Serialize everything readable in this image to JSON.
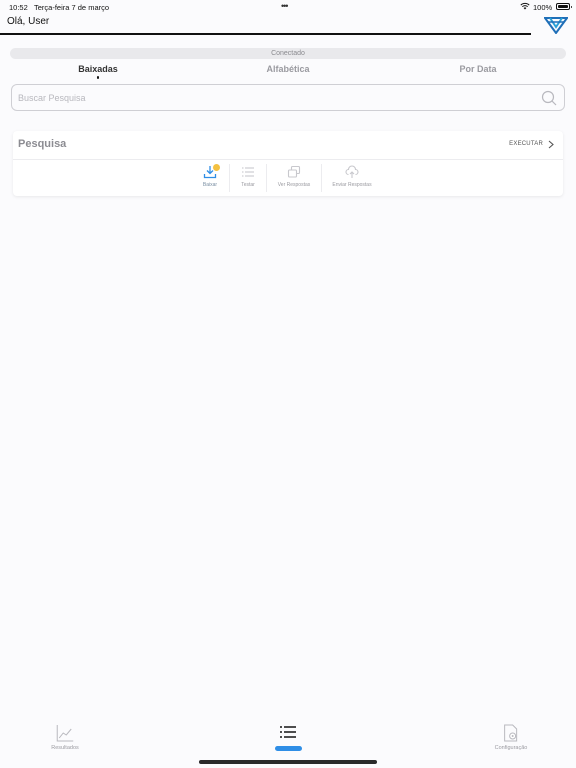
{
  "status": {
    "time": "10:52",
    "date": "Terça-feira 7 de março",
    "dots": "•••",
    "battery_pct": "100%"
  },
  "header": {
    "greeting": "Olá, User"
  },
  "connection": {
    "status_text": "Conectado"
  },
  "tabs": [
    {
      "label": "Baixadas",
      "active": true
    },
    {
      "label": "Alfabética",
      "active": false
    },
    {
      "label": "Por Data",
      "active": false
    }
  ],
  "search": {
    "placeholder": "Buscar Pesquisa"
  },
  "card": {
    "title": "Pesquisa",
    "run_label": "EXECUTAR",
    "actions": [
      {
        "label": "Baixar",
        "icon": "download-icon"
      },
      {
        "label": "Testar",
        "icon": "list-icon"
      },
      {
        "label": "Ver Respostas",
        "icon": "copy-icon"
      },
      {
        "label": "Enviar Respostas",
        "icon": "cloud-upload-icon"
      }
    ]
  },
  "bottom_nav": [
    {
      "label": "Resultados",
      "icon": "chart-icon"
    },
    {
      "label": "",
      "icon": "list-icon",
      "active": true
    },
    {
      "label": "Configuração",
      "icon": "settings-doc-icon"
    }
  ],
  "colors": {
    "accent": "#2f8ee6",
    "badge": "#f4c141",
    "background": "#fbfbfd"
  }
}
